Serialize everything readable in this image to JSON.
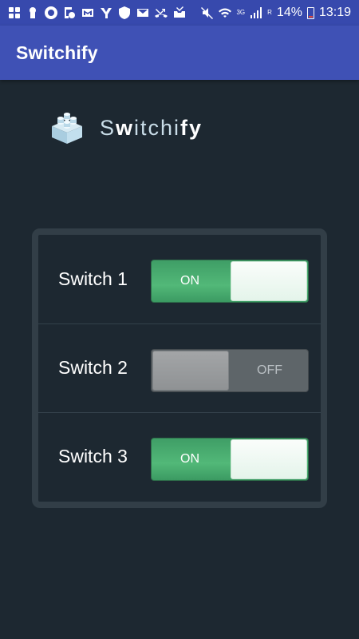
{
  "status_bar": {
    "network": "3G",
    "roaming": "R",
    "battery": "14%",
    "time": "13:19",
    "icons": [
      "widget-icon",
      "keyhole-icon",
      "ring-icon",
      "screenshot-icon",
      "gmail-icon",
      "yahoo-icon",
      "shield-icon",
      "mail-icon",
      "missed-call-icon",
      "inbox-icon",
      "mute-icon",
      "wifi-icon",
      "signal-icon",
      "battery-icon"
    ]
  },
  "app_bar": {
    "title": "Switchify"
  },
  "logo": {
    "text_part1": "S",
    "text_part2": "w",
    "text_part3": "itchi",
    "text_part4": "fy",
    "icon": "lego-brick-icon"
  },
  "switches": [
    {
      "label": "Switch 1",
      "state_text": "ON",
      "on": true
    },
    {
      "label": "Switch 2",
      "state_text": "OFF",
      "on": false
    },
    {
      "label": "Switch 3",
      "state_text": "ON",
      "on": true
    }
  ],
  "colors": {
    "app_bar": "#3f51b5",
    "background": "#1d2831",
    "toggle_on": "#4caf74",
    "toggle_off": "#5e6569"
  }
}
